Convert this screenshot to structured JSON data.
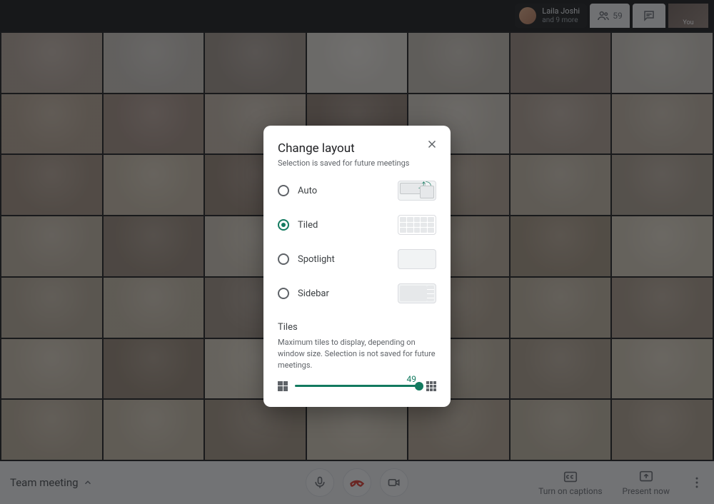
{
  "top": {
    "joined_name": "Laila Joshi",
    "joined_more": "and 9 more",
    "participant_count": "59",
    "self_label": "You"
  },
  "bottom": {
    "meeting_name": "Team meeting",
    "captions_label": "Turn on captions",
    "present_label": "Present now"
  },
  "dialog": {
    "title": "Change layout",
    "subtitle": "Selection is saved for future meetings",
    "options": {
      "auto": "Auto",
      "tiled": "Tiled",
      "spotlight": "Spotlight",
      "sidebar": "Sidebar"
    },
    "selected": "tiled",
    "tiles_heading": "Tiles",
    "tiles_desc": "Maximum tiles to display, depending on window size. Selection is not saved for future meetings.",
    "slider_value": "49"
  },
  "grid": {
    "tile_colors": [
      "#b9a89a",
      "#cfc8bf",
      "#a29488",
      "#e7e1d7",
      "#c9c0b3",
      "#9b8a7b",
      "#d6cfc3",
      "#bba893",
      "#a79082",
      "#c7b9a8",
      "#8f7c6d",
      "#d9d0c2",
      "#b3a292",
      "#c2b4a2",
      "#a6927f",
      "#cdbfa9",
      "#988473",
      "#dcd2c1",
      "#b8a793",
      "#c7baa6",
      "#afa08e",
      "#c6b8a4",
      "#9a8876",
      "#d4c9b7",
      "#b2a18d",
      "#c0b19c",
      "#a8967f",
      "#d8cdb9",
      "#bcae99",
      "#c9bca7",
      "#a19181",
      "#d1c5b1",
      "#b6a690",
      "#c3b59f",
      "#ab9a86",
      "#cec1ac",
      "#978571",
      "#dbd0bc",
      "#b9a993",
      "#c6b9a3",
      "#ae9e89",
      "#d3c7b2",
      "#bfb09a",
      "#cabda7",
      "#a4937f",
      "#d6cab5",
      "#baaa94",
      "#c4b7a1",
      "#b0a08b"
    ]
  }
}
